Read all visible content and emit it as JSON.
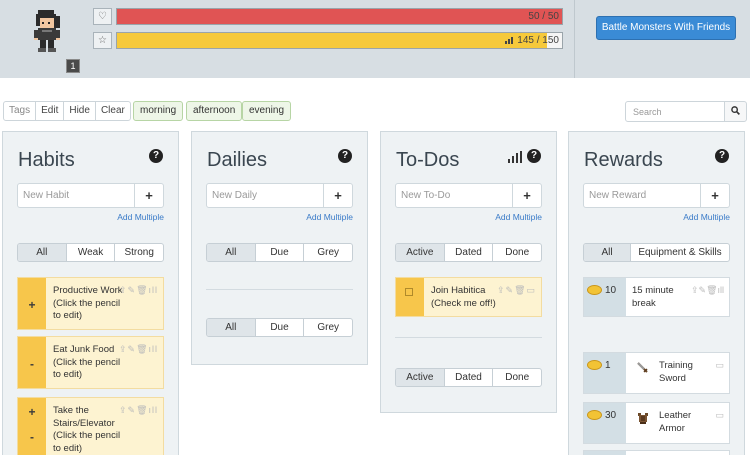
{
  "header": {
    "level": "1",
    "health": {
      "icon": "heart-icon",
      "text": "50 / 50",
      "fraction": 1.0
    },
    "experience": {
      "icon": "star-icon",
      "text": "145 / 150",
      "fraction": 0.967
    },
    "party_button": "Battle Monsters With Friends"
  },
  "toolbar": {
    "buttons": [
      "Tags",
      "Edit",
      "Hide",
      "Clear"
    ],
    "filters": [
      "morning",
      "afternoon",
      "evening"
    ],
    "search_placeholder": "Search"
  },
  "habits": {
    "title": "Habits",
    "placeholder": "New Habit",
    "add_multiple": "Add Multiple",
    "filters": [
      "All",
      "Weak",
      "Strong"
    ],
    "items": [
      {
        "text": "Productive Work (Click the pencil to edit)",
        "controls": [
          "+"
        ]
      },
      {
        "text": "Eat Junk Food (Click the pencil to edit)",
        "controls": [
          "-"
        ]
      },
      {
        "text": "Take the Stairs/Elevator (Click the pencil to edit)",
        "controls": [
          "+",
          "-"
        ]
      }
    ]
  },
  "dailies": {
    "title": "Dailies",
    "placeholder": "New Daily",
    "add_multiple": "Add Multiple",
    "filters": [
      "All",
      "Due",
      "Grey"
    ]
  },
  "todos": {
    "title": "To-Dos",
    "placeholder": "New To-Do",
    "add_multiple": "Add Multiple",
    "filters": [
      "Active",
      "Dated",
      "Done"
    ],
    "items": [
      {
        "text": "Join Habitica (Check me off!)"
      }
    ]
  },
  "rewards": {
    "title": "Rewards",
    "placeholder": "New Reward",
    "add_multiple": "Add Multiple",
    "filters": [
      "All",
      "Equipment & Skills"
    ],
    "custom": [
      {
        "price": "10",
        "text": "15 minute break"
      }
    ],
    "shop": [
      {
        "price": "1",
        "text": "Training Sword",
        "icon": "sword-icon"
      },
      {
        "price": "30",
        "text": "Leather Armor",
        "icon": "armor-icon"
      }
    ]
  },
  "colors": {
    "health": "#e05454",
    "experience": "#f6c93b",
    "task_yellow": "#f7c64b",
    "primary_button": "#3a8bd6"
  }
}
